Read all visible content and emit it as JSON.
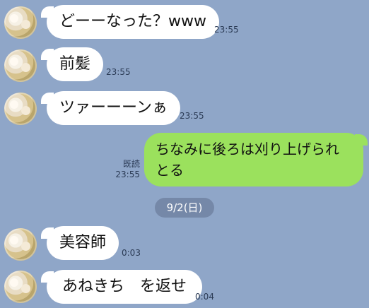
{
  "messages": [
    {
      "side": "in",
      "text": "どーーなった？www",
      "time": "23:55"
    },
    {
      "side": "in",
      "text": "前髪",
      "time": "23:55"
    },
    {
      "side": "in",
      "text": "ツァーーーンぁ",
      "time": "23:55"
    },
    {
      "side": "out",
      "text": "ちなみに後ろは刈り上げられとる",
      "read": "既読",
      "time": "23:55"
    },
    {
      "side": "in",
      "text": "美容師",
      "time": "0:03"
    },
    {
      "side": "in",
      "text": "あねきち　を返せ",
      "time": "0:04"
    }
  ],
  "date_separator": "9/2(日)",
  "colors": {
    "background": "#8fa6c8",
    "incoming_bubble": "#ffffff",
    "outgoing_bubble": "#9be15d",
    "date_pill": "#7588a8"
  },
  "icons": {
    "avatar": "avatar-image"
  }
}
